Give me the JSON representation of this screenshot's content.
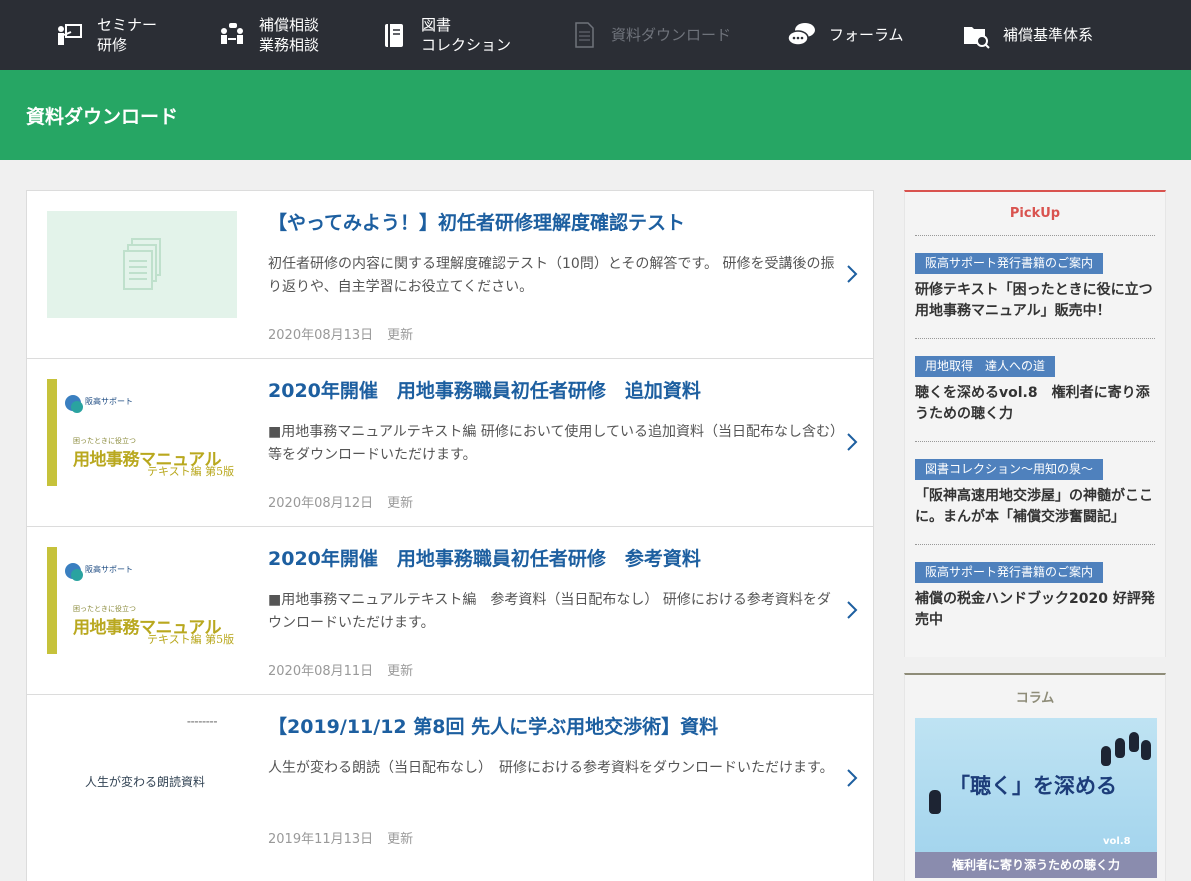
{
  "nav": [
    {
      "label": "セミナー\n研修",
      "icon": "seminar-icon",
      "disabled": false
    },
    {
      "label": "補償相談\n業務相談",
      "icon": "consult-icon",
      "disabled": false
    },
    {
      "label": "図書\nコレクション",
      "icon": "book-icon",
      "disabled": false
    },
    {
      "label": "資料ダウンロード",
      "icon": "document-icon",
      "disabled": true
    },
    {
      "label": "フォーラム",
      "icon": "forum-icon",
      "disabled": false
    },
    {
      "label": "補償基準体系",
      "icon": "folder-search-icon",
      "disabled": false
    }
  ],
  "banner": {
    "title": "資料ダウンロード"
  },
  "items": [
    {
      "title": "【やってみよう！】初任者研修理解度確認テスト",
      "desc": "初任者研修の内容に関する理解度確認テスト（10問）とその解答です。 研修を受講後の振り返りや、自主学習にお役立てください。",
      "date": "2020年08月13日",
      "updated": "更新",
      "thumb": "placeholder"
    },
    {
      "title": "2020年開催　用地事務職員初任者研修　追加資料",
      "desc": "■用地事務マニュアルテキスト編 研修において使用している追加資料（当日配布なし含む）等をダウンロードいただけます。",
      "date": "2020年08月12日",
      "updated": "更新",
      "thumb": "book"
    },
    {
      "title": "2020年開催　用地事務職員初任者研修　参考資料",
      "desc": "■用地事務マニュアルテキスト編　参考資料（当日配布なし） 研修における参考資料をダウンロードいただけます。",
      "date": "2020年08月11日",
      "updated": "更新",
      "thumb": "book"
    },
    {
      "title": "【2019/11/12 第8回 先人に学ぶ用地交渉術】資料",
      "desc": "人生が変わる朗読（当日配布なし）　研修における参考資料をダウンロードいただけます。",
      "date": "2019年11月13日",
      "updated": "更新",
      "thumb": "plain"
    }
  ],
  "book_cover": {
    "brand": "阪高サポート",
    "small": "困ったときに役立つ",
    "big": "用地事務マニュアル",
    "sub": "テキスト編 第5版"
  },
  "plain_cover": {
    "text": "人生が変わる朗読資料"
  },
  "pickup": {
    "heading": "PickUp",
    "items": [
      {
        "tag": "阪高サポート発行書籍のご案内",
        "text": "研修テキスト「困ったときに役に立つ用地事務マニュアル」販売中！"
      },
      {
        "tag": "用地取得　達人への道",
        "text": "聴くを深めるvol.8　権利者に寄り添うための聴く力"
      },
      {
        "tag": "図書コレクション～用知の泉～",
        "text": "「阪神高速用地交渉屋」の神髄がここに。まんが本「補償交渉奮闘記」"
      },
      {
        "tag": "阪高サポート発行書籍のご案内",
        "text": "補償の税金ハンドブック2020 好評発売中"
      }
    ]
  },
  "column": {
    "heading": "コラム",
    "banner_title": "「聴く」を深める",
    "banner_vol": "vol.8",
    "banner_foot": "権利者に寄り添うための聴く力"
  },
  "colors": {
    "nav_bg": "#2b2e35",
    "banner_bg": "#26a664",
    "title_blue": "#1d5fa0",
    "tag_blue": "#4f81bd",
    "pickup_red": "#d9534f"
  }
}
